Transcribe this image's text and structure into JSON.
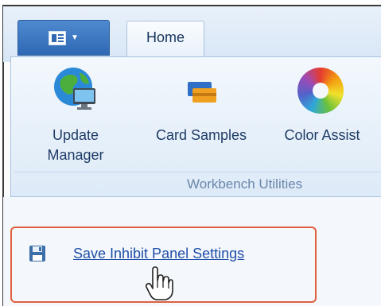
{
  "ribbon": {
    "tab_home": "Home",
    "items": [
      {
        "icon": "globe-monitor-icon",
        "line1": "Update",
        "line2": "Manager"
      },
      {
        "icon": "card-samples-icon",
        "line1": "Card Samples",
        "line2": ""
      },
      {
        "icon": "color-wheel-icon",
        "line1": "Color Assist",
        "line2": ""
      }
    ],
    "group_label": "Workbench Utilities"
  },
  "panel": {
    "save_icon": "floppy-disk-icon",
    "save_link": "Save Inhibit Panel Settings",
    "cursor": "hand-cursor-icon"
  },
  "colors": {
    "app_button": "#3a78c4",
    "highlight_border": "#e0603f",
    "link": "#1f4fa8"
  }
}
